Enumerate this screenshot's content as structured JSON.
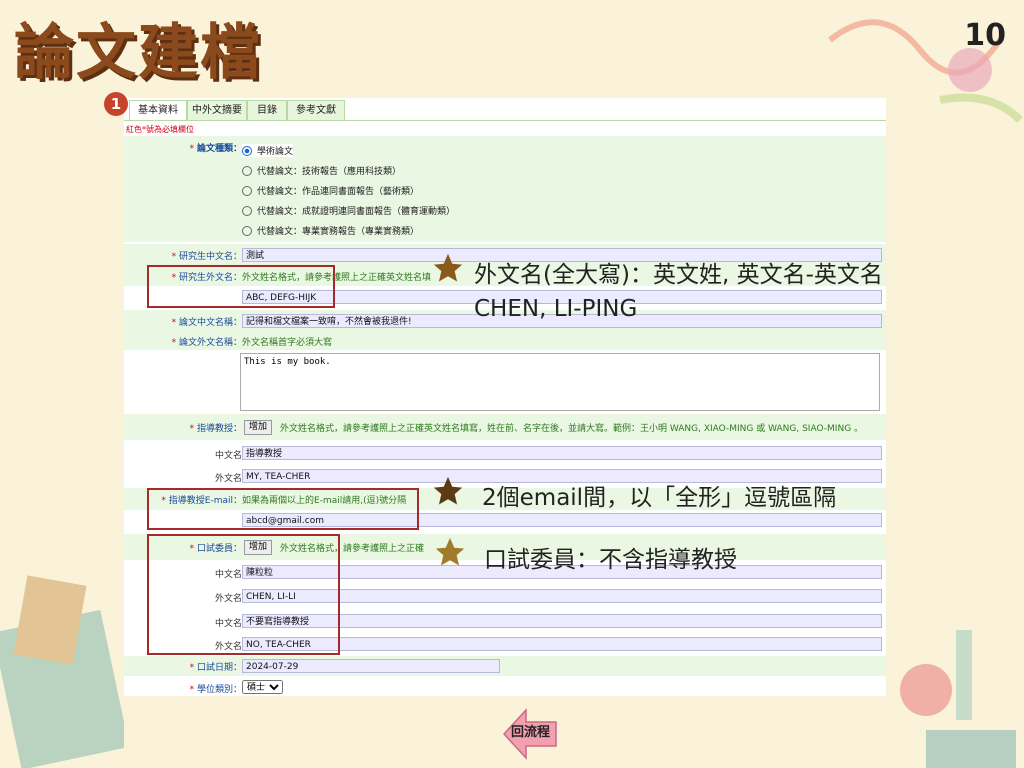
{
  "slide": {
    "title": "論文建檔",
    "page": "10"
  },
  "tabs": [
    {
      "label": "基本資料"
    },
    {
      "label": "中外文摘要"
    },
    {
      "label": "目錄"
    },
    {
      "label": "參考文獻"
    }
  ],
  "step": "1",
  "required_note": "紅色*號為必填欄位",
  "form": {
    "type_label": "論文種類：",
    "types": [
      "學術論文",
      "代替論文：技術報告（應用科技類）",
      "代替論文：作品連同書面報告（藝術類）",
      "代替論文：成就證明連同書面報告（體育運動類）",
      "代替論文：專業實務報告（專業實務類）"
    ],
    "student_cn_label": "研究生中文名：",
    "student_cn": "測試",
    "student_en_label": "研究生外文名：",
    "student_en_hint": "外文姓名格式，請參考護照上之正確英文姓名填",
    "student_en": "ABC, DEFG-HIJK",
    "title_cn_label": "論文中文名稱：",
    "title_cn": "記得和檔文檔案一致唷，不然會被我退件!",
    "title_en_label": "論文外文名稱：",
    "title_en_hint": "外文名稱首字必須大寫",
    "title_en": "This is my book.",
    "advisor_label": "指導教授：",
    "add": "增加",
    "advisor_hint": "外文姓名格式，請參考護照上之正確英文姓名填寫，姓在前、名字在後，並請大寫。範例：王小明 WANG, XIAO-MING 或 WANG, SIAO-MING 。",
    "cn_name": "中文名",
    "en_name": "外文名",
    "advisor_cn": "指導教授",
    "advisor_en": "MY, TEA-CHER",
    "email_label": "指導教授E-mail：",
    "email_hint": "如果為兩個以上的E-mail請用,(逗)號分隔",
    "email": "abcd@gmail.com",
    "committee_label": "口試委員：",
    "committee_hint": "外文姓名格式，請參考護照上之正確",
    "c1_cn": "陳粒粒",
    "c1_en": "CHEN, LI-LI",
    "c2_cn": "不要寫指導教授",
    "c2_en": "NO, TEA-CHER",
    "date_label": "口試日期：",
    "date": "2024-07-29",
    "degree_label": "學位類別：",
    "degree": "碩士"
  },
  "callouts": {
    "c1_line1": "外文名(全大寫)：英文姓, 英文名-英文名",
    "c1_line2": "CHEN, LI-PING",
    "c2": "2個email間，以「全形」逗號區隔",
    "c3": "口試委員：不含指導教授"
  },
  "back_button": "回流程",
  "colors": {
    "bg": "#faf3da",
    "title": "#8a4a1c",
    "panel_green": "#eaf7e2",
    "box": "#a52a2a",
    "star": "#8a5a1a"
  }
}
